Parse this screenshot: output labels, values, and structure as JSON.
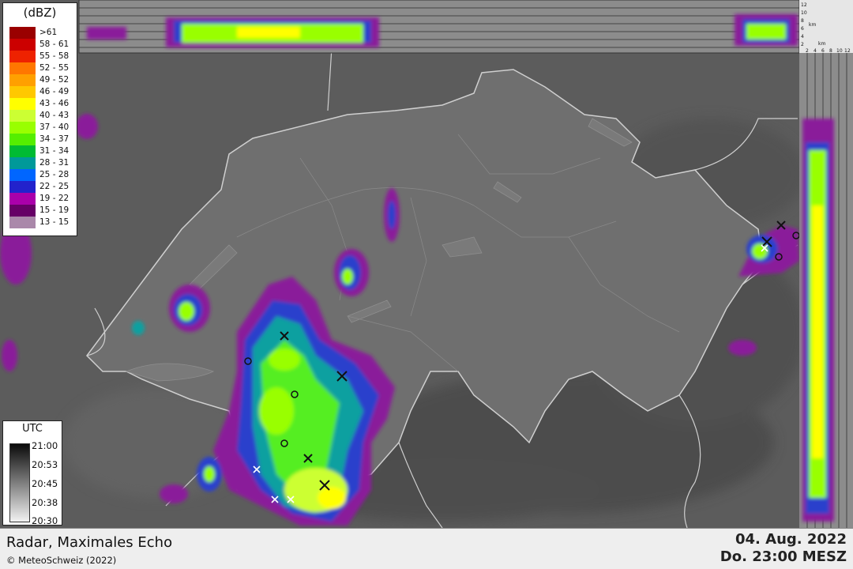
{
  "legend": {
    "title": "(dBZ)",
    "items": [
      {
        "label": ">61",
        "color": "#9a0000"
      },
      {
        "label": "58 - 61",
        "color": "#cc0000"
      },
      {
        "label": "55 - 58",
        "color": "#ee2200"
      },
      {
        "label": "52 - 55",
        "color": "#ff7700"
      },
      {
        "label": "49 - 52",
        "color": "#ffa000"
      },
      {
        "label": "46 - 49",
        "color": "#ffc800"
      },
      {
        "label": "43 - 46",
        "color": "#ffff00"
      },
      {
        "label": "40 - 43",
        "color": "#ccff33"
      },
      {
        "label": "37 - 40",
        "color": "#99ff00"
      },
      {
        "label": "34 - 37",
        "color": "#55ee00"
      },
      {
        "label": "31 - 34",
        "color": "#00bb33"
      },
      {
        "label": "28 - 31",
        "color": "#009999"
      },
      {
        "label": "25 - 28",
        "color": "#0066ff"
      },
      {
        "label": "22 - 25",
        "color": "#2222cc"
      },
      {
        "label": "19 - 22",
        "color": "#aa00aa"
      },
      {
        "label": "15 - 19",
        "color": "#660066"
      },
      {
        "label": "13 - 15",
        "color": "#aa88aa"
      }
    ]
  },
  "utc": {
    "title": "UTC",
    "ticks": [
      "21:00",
      "20:53",
      "20:45",
      "20:38",
      "20:30"
    ]
  },
  "footer": {
    "product": "Radar, Maximales Echo",
    "copyright": "© MeteoSchweiz (2022)",
    "date": "04. Aug. 2022",
    "time": "Do. 23:00 MESZ"
  },
  "profile": {
    "top_km": [
      "12",
      "10",
      "8",
      "6",
      "4",
      "2"
    ],
    "side_km": [
      "2",
      "4",
      "6",
      "8",
      "10",
      "12"
    ],
    "unit": "km"
  }
}
